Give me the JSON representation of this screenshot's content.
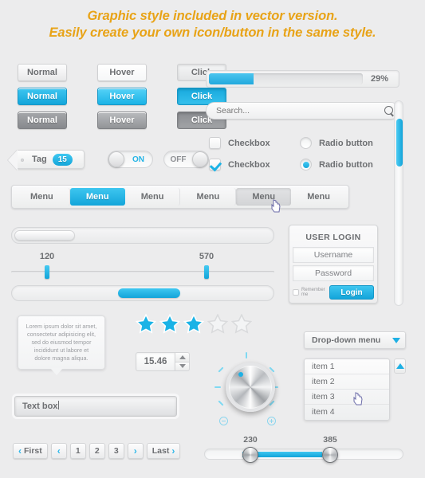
{
  "header": {
    "line1": "Graphic style included in vector version.",
    "line2": "Easily create your own icon/button in the same style."
  },
  "colors": {
    "accent_blue": "#1bb3e6",
    "header_orange": "#e8a317",
    "background": "#ececed",
    "text": "#6d6f72"
  },
  "buttons": {
    "rows": [
      {
        "state": "light",
        "labels": [
          "Normal",
          "Hover",
          "Click"
        ]
      },
      {
        "state": "blue",
        "labels": [
          "Normal",
          "Hover",
          "Click"
        ]
      },
      {
        "state": "gray",
        "labels": [
          "Normal",
          "Hover",
          "Click"
        ]
      }
    ]
  },
  "progress": {
    "value_label": "29%",
    "percent": 29
  },
  "search": {
    "placeholder": "Search...",
    "value": "",
    "icon": "search-icon"
  },
  "checkboxes": [
    {
      "label": "Checkbox",
      "checked": false
    },
    {
      "label": "Checkbox",
      "checked": true
    }
  ],
  "radios": [
    {
      "label": "Radio button",
      "checked": false
    },
    {
      "label": "Radio button",
      "checked": true
    }
  ],
  "tag": {
    "label": "Tag",
    "count": "15"
  },
  "toggles": [
    {
      "label": "ON",
      "state": "on"
    },
    {
      "label": "OFF",
      "state": "off"
    }
  ],
  "menu": {
    "items": [
      {
        "label": "Menu",
        "state": "normal"
      },
      {
        "label": "Menu",
        "state": "active"
      },
      {
        "label": "Menu",
        "state": "normal"
      },
      {
        "label": "Menu",
        "state": "normal"
      },
      {
        "label": "Menu",
        "state": "hover"
      },
      {
        "label": "Menu",
        "state": "normal"
      }
    ]
  },
  "range_slider": {
    "min_label": "120",
    "max_label": "570"
  },
  "login": {
    "title": "USER LOGIN",
    "username_placeholder": "Username",
    "password_placeholder": "Password",
    "remember_label": "Remember me",
    "button_label": "Login"
  },
  "tooltip": {
    "text": "Lorem ipsum dolor sit amet, consectetur adipisicing elit, sed do eiusmod tempor incididunt ut labore et dolore magna aliqua."
  },
  "rating": {
    "total": 5,
    "filled": 3
  },
  "stepper": {
    "value": "15.46"
  },
  "knob": {
    "indicator": "blue-dot",
    "minus_icon": "minus-circle-icon",
    "plus_icon": "plus-circle-icon"
  },
  "textbox": {
    "value": "Text box"
  },
  "dropdown": {
    "label": "Drop-down menu",
    "icon": "chevron-down-icon"
  },
  "list": {
    "items": [
      "item 1",
      "item 2",
      "item 3",
      "item 4"
    ],
    "hovered_index": 2,
    "scroll_icon": "chevron-up-icon"
  },
  "pagination": {
    "first_label": "First",
    "last_label": "Last",
    "prev_icon": "chevron-left-icon",
    "next_icon": "chevron-right-icon",
    "pages": [
      "1",
      "2",
      "3"
    ]
  },
  "dual_slider": {
    "left_label": "230",
    "right_label": "385"
  }
}
